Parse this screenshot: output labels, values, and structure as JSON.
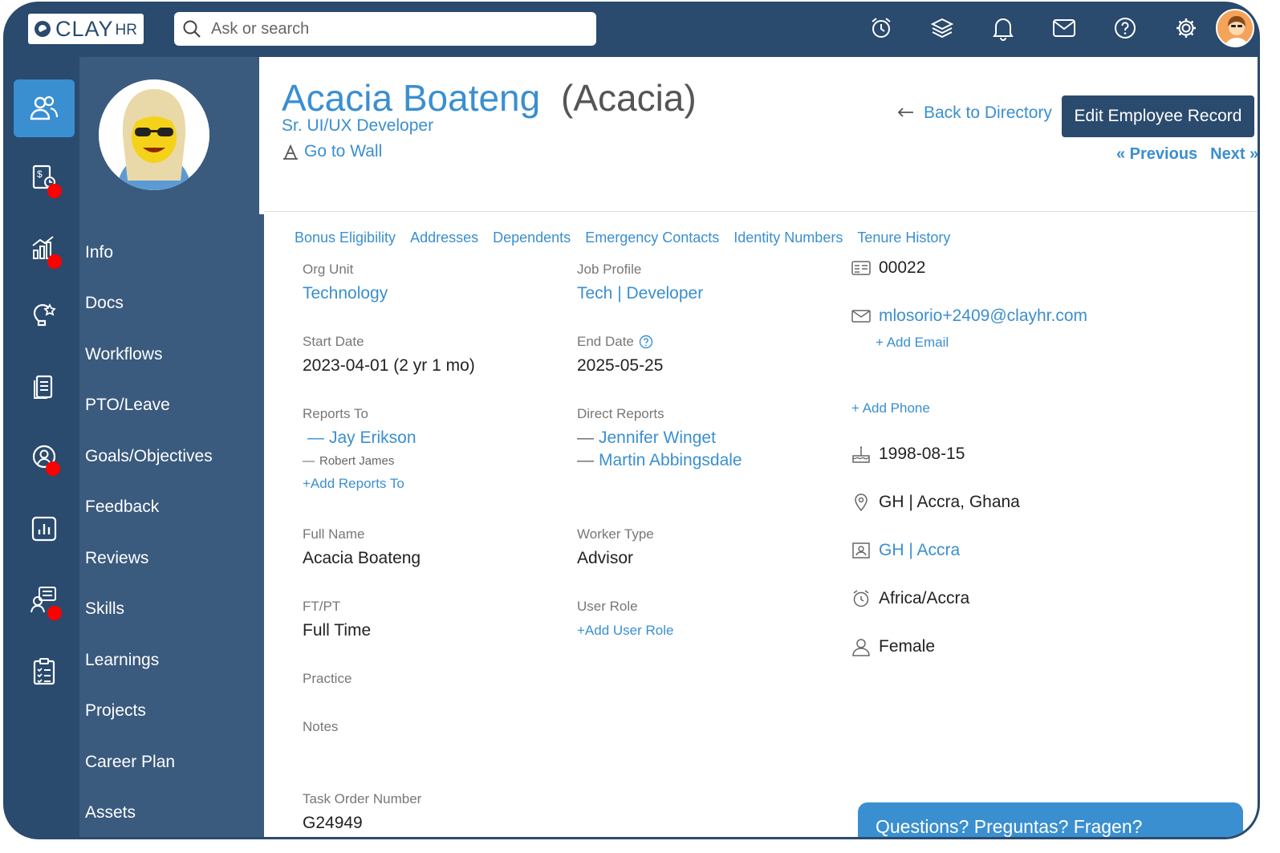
{
  "app": {
    "logo_text": "CLAY",
    "logo_sub": "HR",
    "search_placeholder": "Ask or search"
  },
  "top_icons": [
    "alarm-clock-icon",
    "layers-icon",
    "bell-icon",
    "mail-icon",
    "help-icon",
    "settings-icon"
  ],
  "rail_icons": [
    {
      "name": "people-icon",
      "active": true,
      "dot": false
    },
    {
      "name": "payroll-icon",
      "active": false,
      "dot": true
    },
    {
      "name": "analytics-icon",
      "active": false,
      "dot": true
    },
    {
      "name": "idea-icon",
      "active": false,
      "dot": false
    },
    {
      "name": "documents-icon",
      "active": false,
      "dot": false
    },
    {
      "name": "profile-circle-icon",
      "active": false,
      "dot": true
    },
    {
      "name": "report-chart-icon",
      "active": false,
      "dot": false
    },
    {
      "name": "team-board-icon",
      "active": false,
      "dot": true
    },
    {
      "name": "checklist-icon",
      "active": false,
      "dot": false
    }
  ],
  "nav": {
    "items": [
      "Info",
      "Docs",
      "Workflows",
      "PTO/Leave",
      "Goals/Objectives",
      "Feedback",
      "Reviews",
      "Skills",
      "Learnings",
      "Projects",
      "Career Plan",
      "Assets"
    ]
  },
  "employee": {
    "name": "Acacia Boateng",
    "nickname": "(Acacia)",
    "title": "Sr. UI/UX Developer",
    "go_to_wall": "Go to Wall"
  },
  "actions": {
    "back": "Back to Directory",
    "edit": "Edit Employee Record",
    "previous": "« Previous",
    "next": "Next »"
  },
  "tabs": [
    "Bonus Eligibility",
    "Addresses",
    "Dependents",
    "Emergency Contacts",
    "Identity Numbers",
    "Tenure History"
  ],
  "fields": {
    "org_unit": {
      "label": "Org Unit",
      "value": "Technology"
    },
    "job_profile": {
      "label": "Job Profile",
      "value": "Tech | Developer"
    },
    "start_date": {
      "label": "Start Date",
      "value": "2023-04-01 (2 yr 1 mo)"
    },
    "end_date": {
      "label": "End Date",
      "value": "2025-05-25"
    },
    "reports_to": {
      "label": "Reports To",
      "primary": "Jay Erikson",
      "secondary": "Robert James",
      "add": "+Add Reports To"
    },
    "direct_reports": {
      "label": "Direct Reports",
      "items": [
        "Jennifer Winget",
        "Martin Abbingsdale"
      ]
    },
    "full_name": {
      "label": "Full Name",
      "value": "Acacia Boateng"
    },
    "worker_type": {
      "label": "Worker Type",
      "value": "Advisor"
    },
    "ftpt": {
      "label": "FT/PT",
      "value": "Full Time"
    },
    "user_role": {
      "label": "User Role",
      "add": "+Add User Role"
    },
    "practice": {
      "label": "Practice"
    },
    "notes": {
      "label": "Notes"
    },
    "task_order": {
      "label": "Task Order Number",
      "value": "G24949"
    }
  },
  "contact": {
    "employee_id": "00022",
    "email": "mlosorio+2409@clayhr.com",
    "add_email": "+ Add Email",
    "add_phone": "+ Add Phone",
    "birthday": "1998-08-15",
    "location": "GH | Accra, Ghana",
    "office": "GH | Accra",
    "timezone": "Africa/Accra",
    "gender": "Female"
  },
  "chat": {
    "label": "Questions? Preguntas? Fragen?"
  },
  "colors": {
    "primary": "#2a4a6e",
    "accent": "#3a8fd0",
    "subnav": "#3a5a7e",
    "badge": "#ff0000"
  }
}
